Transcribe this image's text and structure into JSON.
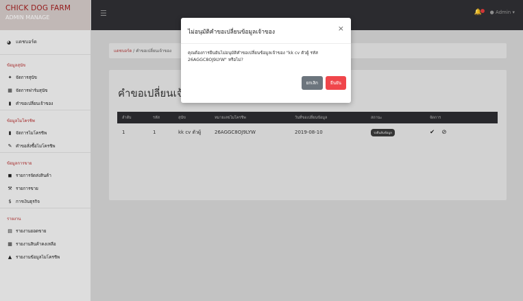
{
  "brand": {
    "title": "CHICK DOG FARM",
    "subtitle": "ADMIN MANAGE"
  },
  "sidebar": {
    "dashboard": "แดชบอร์ด",
    "sections": [
      {
        "title": "ข้อมูลสุนัข",
        "items": [
          {
            "icon": "paw",
            "label": "จัดการสุนัข"
          },
          {
            "icon": "table",
            "label": "จัดการฟาร์มสุนัข"
          },
          {
            "icon": "bookmark",
            "label": "คำขอเปลี่ยนเจ้าของ"
          }
        ]
      },
      {
        "title": "ข้อมูลไมโครชิพ",
        "items": [
          {
            "icon": "chip",
            "label": "จัดการไมโครชิพ"
          },
          {
            "icon": "pen",
            "label": "คำขอสั่งซื้อไมโครชิพ"
          }
        ]
      },
      {
        "title": "ข้อมูลการขาย",
        "items": [
          {
            "icon": "truck",
            "label": "รายการจัดส่งสินค้า"
          },
          {
            "icon": "gavel",
            "label": "รายการขาย"
          },
          {
            "icon": "dollar",
            "label": "การเงินธุรกิจ"
          }
        ]
      },
      {
        "title": "รายงาน",
        "items": [
          {
            "icon": "doc",
            "label": "รายงานยอดขาย"
          },
          {
            "icon": "calendar",
            "label": "รายงานสินค้าคงเหลือ"
          },
          {
            "icon": "chart",
            "label": "รายงานข้อมูลไมโครชิพ"
          }
        ]
      }
    ]
  },
  "topbar": {
    "user": "Admin",
    "notifications": "3"
  },
  "breadcrumb": {
    "home": "แดชบอร์ด",
    "current": "คำขอเปลี่ยนเจ้าของ"
  },
  "page": {
    "title": "คำขอเปลี่ยนเจ้าของ"
  },
  "table": {
    "headers": [
      "ลำดับ",
      "รหัส",
      "สุนัข",
      "หมายเลขไมโครชิพ",
      "วันที่ขอเปลี่ยนข้อมูล",
      "สถานะ",
      "จัดการ"
    ],
    "rows": [
      {
        "no": "1",
        "id": "1",
        "dog": "kk cv ตัวผู้",
        "chip": "26AGGC8OJ9LYW",
        "date": "2019-08-10",
        "status": "รอยืนยันข้อมูล"
      }
    ]
  },
  "modal": {
    "title": "ไม่อนุมัติคำขอเปลี่ยนข้อมูลเจ้าของ",
    "close": "×",
    "message": "คุณต้องการยืนยันไม่อนุมัติคำขอเปลี่ยนข้อมูลเจ้าของ \"kk cv ตัวผู้ รหัส 26AGGC8OJ9LYW\" หรือไม่?",
    "cancel": "ยกเลิก",
    "confirm": "ยืนยัน"
  },
  "colors": {
    "accent": "#b32b2b",
    "confirm": "#f0464b",
    "cancel": "#6c757d",
    "topbar": "#2f2f33"
  }
}
